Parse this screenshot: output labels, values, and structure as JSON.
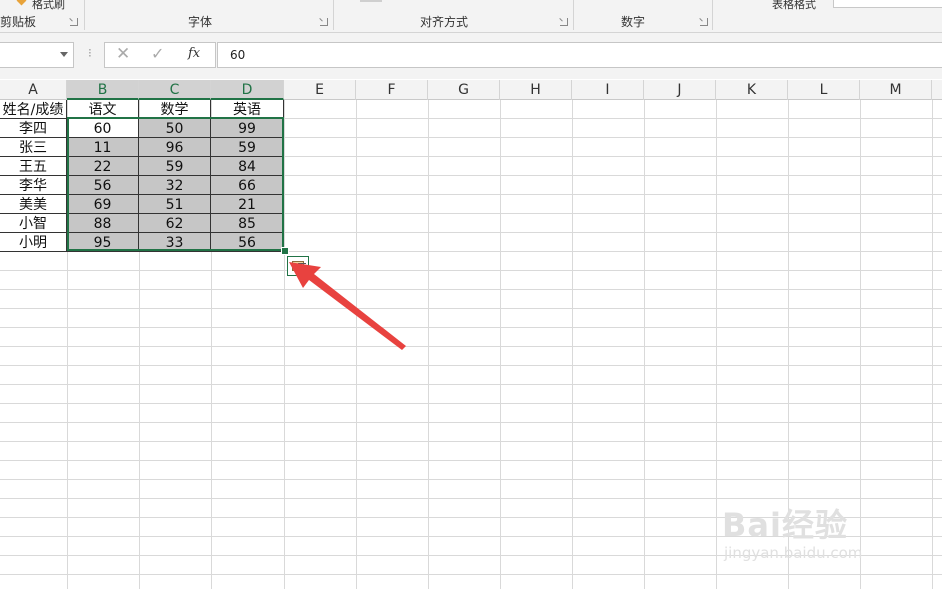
{
  "ribbon": {
    "cut_labels": [
      "格式刷",
      "表格格式"
    ],
    "groups": [
      "剪贴板",
      "字体",
      "对齐方式",
      "数字"
    ]
  },
  "formula_bar": {
    "name_box": "",
    "cancel_icon": "close-icon",
    "enter_icon": "check-icon",
    "fx_label": "fx",
    "value": "60"
  },
  "columns": [
    "A",
    "B",
    "C",
    "D",
    "E",
    "F",
    "G",
    "H",
    "I",
    "J",
    "K",
    "L",
    "M"
  ],
  "selected_columns": [
    "B",
    "C",
    "D"
  ],
  "table": {
    "header": [
      "姓名/成绩",
      "语文",
      "数学",
      "英语"
    ],
    "rows": [
      [
        "李四",
        "60",
        "50",
        "99"
      ],
      [
        "张三",
        "11",
        "96",
        "59"
      ],
      [
        "王五",
        "22",
        "59",
        "84"
      ],
      [
        "李华",
        "56",
        "32",
        "66"
      ],
      [
        "美美",
        "69",
        "51",
        "21"
      ],
      [
        "小智",
        "88",
        "62",
        "85"
      ],
      [
        "小明",
        "95",
        "33",
        "56"
      ]
    ]
  },
  "quick_analysis": {
    "icon": "quick-analysis-icon"
  },
  "annotation": {
    "arrow_color": "#e8423f"
  },
  "watermark": {
    "main": "Bai经验",
    "sub": "jingyan.baidu.com"
  },
  "colors": {
    "accent": "#217346",
    "selection_fill": "#c6c6c6"
  }
}
